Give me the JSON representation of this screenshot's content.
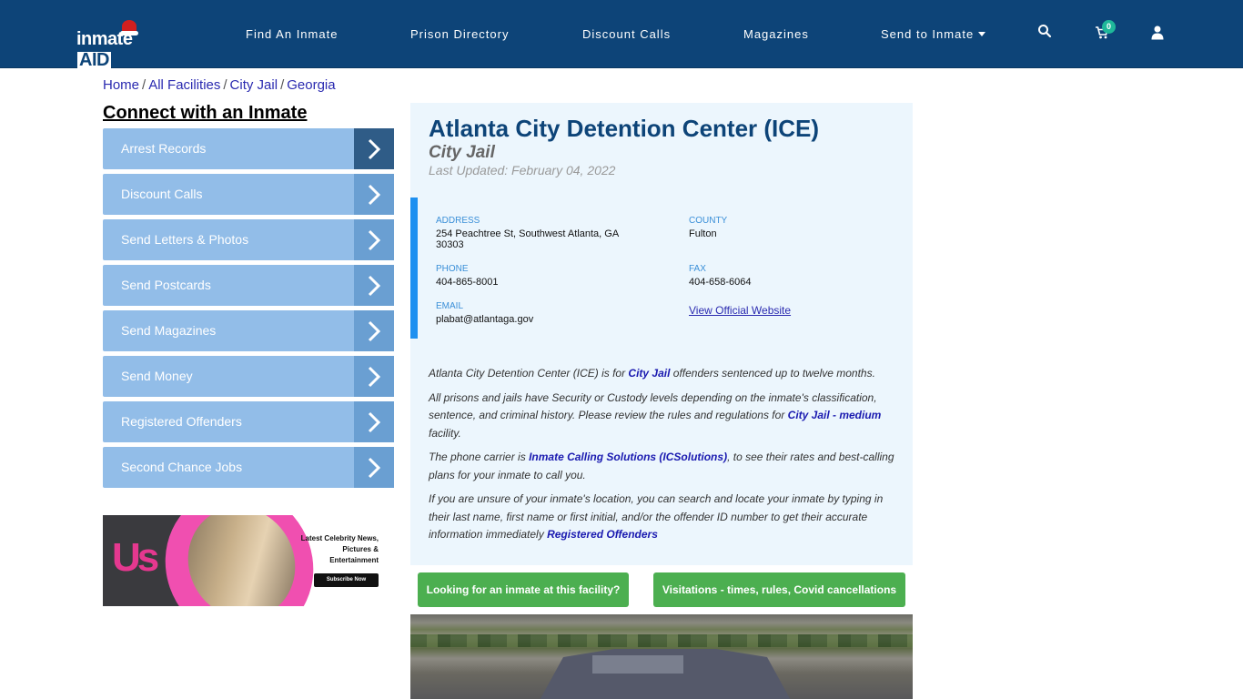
{
  "header": {
    "logo_text": "inmate",
    "logo_accent": "AID",
    "nav": [
      {
        "label": "Find An Inmate"
      },
      {
        "label": "Prison Directory"
      },
      {
        "label": "Discount Calls"
      },
      {
        "label": "Magazines"
      },
      {
        "label": "Send to Inmate",
        "has_dropdown": true
      }
    ],
    "icons": [
      "search-icon",
      "cart-icon",
      "user-icon"
    ],
    "cart_count": "0"
  },
  "breadcrumb": [
    {
      "label": "Home"
    },
    {
      "label": "All Facilities"
    },
    {
      "label": "City Jail"
    },
    {
      "label": "Georgia"
    }
  ],
  "sidebar": {
    "title": "Connect with an Inmate",
    "items": [
      {
        "label": "Arrest Records",
        "active": true
      },
      {
        "label": "Discount Calls"
      },
      {
        "label": "Send Letters & Photos"
      },
      {
        "label": "Send Postcards"
      },
      {
        "label": "Send Magazines"
      },
      {
        "label": "Send Money"
      },
      {
        "label": "Registered Offenders"
      },
      {
        "label": "Second Chance Jobs"
      }
    ],
    "ad": {
      "brand": "Us",
      "headline": "Latest Celebrity News, Pictures & Entertainment",
      "cta": "Subscribe Now"
    }
  },
  "facility": {
    "name": "Atlanta City Detention Center (ICE)",
    "type": "City Jail",
    "last_updated": "Last Updated: February 04, 2022",
    "address_label": "ADDRESS",
    "address_line1": "254 Peachtree St, Southwest Atlanta, GA",
    "address_line2": "30303",
    "county_label": "COUNTY",
    "county": "Fulton",
    "phone_label": "PHONE",
    "phone": "404-865-8001",
    "fax_label": "FAX",
    "fax": "404-658-6064",
    "email_label": "EMAIL",
    "email": "plabat@atlantaga.gov",
    "website_link": "View Official Website"
  },
  "description": {
    "p1_a": "Atlanta City Detention Center (ICE) is for ",
    "p1_link": "City Jail",
    "p1_b": " offenders sentenced up to twelve months.",
    "p2_a": "All prisons and jails have Security or Custody levels depending on the inmate's classification, sentence, and criminal history. Please review the rules and regulations for ",
    "p2_link": "City Jail - medium",
    "p2_b": " facility.",
    "p3_a": "The phone carrier is ",
    "p3_link": "Inmate Calling Solutions (ICSolutions)",
    "p3_b": ", to see their rates and best-calling plans for your inmate to call you.",
    "p4_a": "If you are unsure of your inmate's location, you can search and locate your inmate by typing in their last name, first name or first initial, and/or the offender ID number to get their accurate information immediately ",
    "p4_link": "Registered Offenders"
  },
  "actions": {
    "find_inmate": "Looking for an inmate at this facility?",
    "visitations": "Visitations - times, rules, Covid cancellations"
  },
  "colors": {
    "header_bg": "#0d4478",
    "sidebar_item": "#92bde8",
    "sidebar_arrow": "#6a9fd2",
    "sidebar_arrow_active": "#2f5c87",
    "card_bg": "#ecf6fd",
    "accent_bar": "#1e90f0",
    "button_green": "#4caf50",
    "badge": "#1fb89a"
  }
}
